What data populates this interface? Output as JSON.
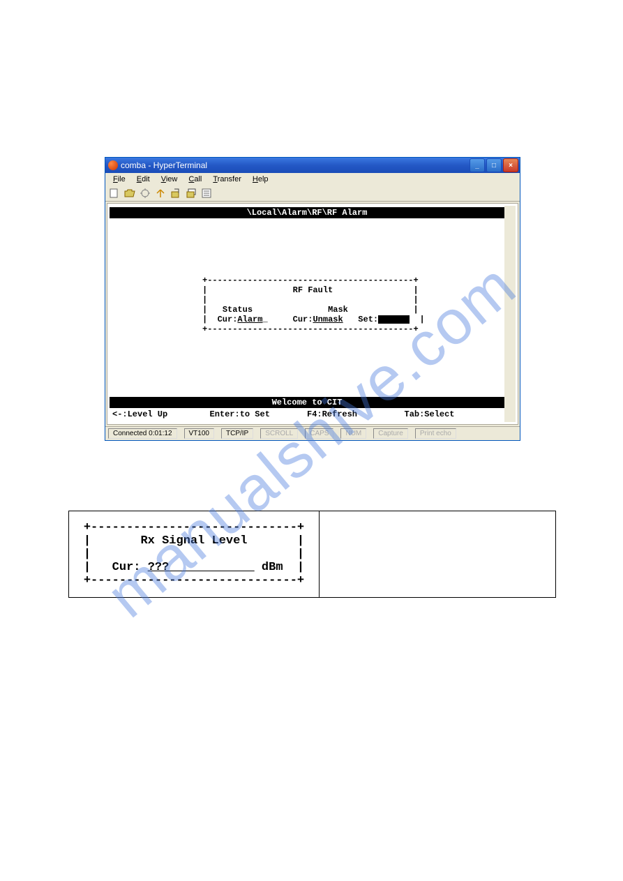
{
  "window": {
    "title": "comba - HyperTerminal",
    "menu": {
      "file": "File",
      "edit": "Edit",
      "view": "View",
      "call": "Call",
      "transfer": "Transfer",
      "help": "Help"
    }
  },
  "terminal": {
    "path": "\\Local\\Alarm\\RF\\RF Alarm",
    "box_title": "RF Fault",
    "status_label": "Status",
    "status_cur_label": "Cur:",
    "status_cur_value": "Alarm",
    "mask_label": "Mask",
    "mask_cur_label": "Cur:",
    "mask_cur_value": "Unmask",
    "mask_set_label": "Set:",
    "banner": "Welcome to CIT",
    "keys": {
      "levelup": "<-:Level Up",
      "enter": "Enter:to Set",
      "f4": "F4:Refresh",
      "tab": "Tab:Select"
    }
  },
  "status": {
    "connected": "Connected 0:01:12",
    "term": "VT100",
    "proto": "TCP/IP",
    "scroll": "SCROLL",
    "caps": "CAPS",
    "num": "NUM",
    "capture": "Capture",
    "print": "Print echo"
  },
  "rx": {
    "title": "Rx Signal Level",
    "cur_label": "Cur:",
    "cur_value": "???",
    "unit": "dBm"
  }
}
